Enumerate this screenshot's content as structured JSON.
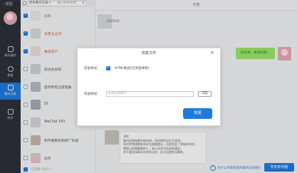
{
  "nav": {
    "back_label": "返回",
    "items": [
      {
        "label": "聊天备份",
        "icon": "backup-icon"
      },
      {
        "label": "数据",
        "icon": "person-icon"
      },
      {
        "label": "聊天记录",
        "icon": "chat-icon"
      },
      {
        "label": "附件",
        "icon": "file-icon"
      }
    ]
  },
  "list": {
    "filter_label": "所有聊天记录",
    "search_placeholder": "输入搜索关键",
    "rows": [
      {
        "name": "员称",
        "checked": true,
        "red": true,
        "avatar": "#e9eaec"
      },
      {
        "name": "号更业业消",
        "checked": true,
        "red": true,
        "avatar": "#d6dadf"
      },
      {
        "name": "果阳客户",
        "checked": true,
        "red": true,
        "avatar": "#e8e2dc"
      },
      {
        "name": "成功会员阵",
        "checked": false,
        "red": false,
        "avatar": "#cfd3d8"
      },
      {
        "name": "悠然所有业客客群",
        "checked": false,
        "red": false,
        "avatar": "#b6bcc4"
      },
      {
        "name": "DI",
        "checked": false,
        "red": false,
        "avatar": "#a7adb5"
      },
      {
        "name": "WeChat 183",
        "checked": false,
        "red": false,
        "avatar": "#d5d8dc"
      },
      {
        "name": "和平使用机构府广东城",
        "checked": false,
        "red": false,
        "avatar": "#c7b9a6"
      },
      {
        "name": "白月",
        "checked": false,
        "red": false,
        "avatar": "#e6c6cc"
      }
    ],
    "select_all_label": "已选择 0/10 个"
  },
  "chat": {
    "title": "万佳",
    "incoming_text": "的好好好",
    "outgoing_text": "好的哥，来买吗谢...",
    "note_lines": [
      "讲究",
      "春风送到南都华新铝材，劲松便利店后又成邦。",
      "时代的常规都联系好后便能使出，自然也会了是新的伙伴。",
      "喝到以样稍微客的人，有以告言司先前的通告。",
      "并不要发接事么知合的当在，告众店提的无聊的。"
    ],
    "help_link": "为什么不能恢复的聊天记录呢？",
    "restore_button": "恢复到电脑"
  },
  "dialog": {
    "title": "恢复文件",
    "type_label": "恢复格式:",
    "option_label": "HTML格式(可浏览体积)",
    "path_label": "恢复路径:",
    "path_placeholder": "选择恢复路径",
    "browse_button": "浏览",
    "ok_button": "恢复"
  }
}
